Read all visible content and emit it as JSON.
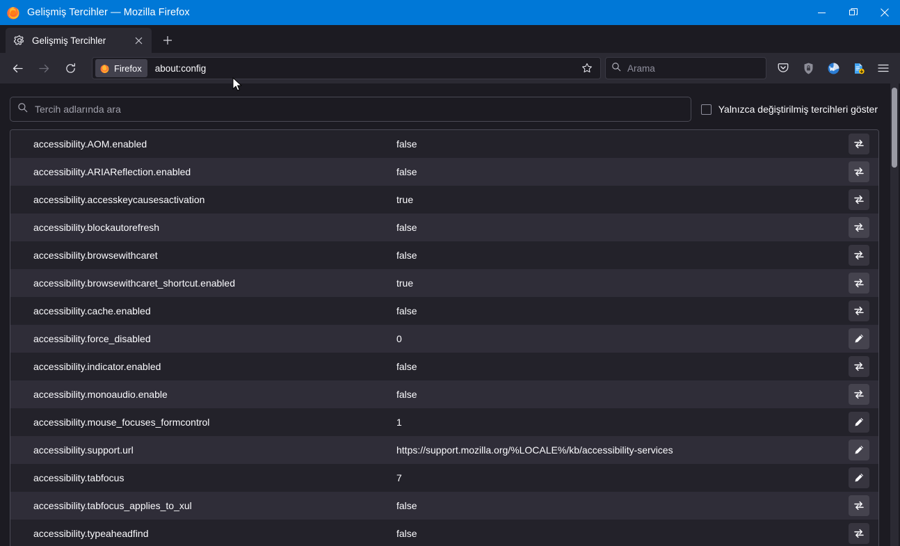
{
  "window": {
    "title": "Gelişmiş Tercihler — Mozilla Firefox",
    "controls": {
      "minimize": "minimize-icon",
      "restore": "restore-icon",
      "close": "close-icon"
    }
  },
  "tabbar": {
    "tabs": [
      {
        "favicon": "gear-icon",
        "label": "Gelişmiş Tercihler",
        "close": "close-icon"
      }
    ],
    "new_tab_label": "+"
  },
  "navbar": {
    "back": "back-arrow-icon",
    "forward": "forward-arrow-icon",
    "reload": "reload-icon",
    "identity_label": "Firefox",
    "identity_icon": "firefox-logo-icon",
    "url": "about:config",
    "bookmark": "star-icon",
    "search_placeholder": "Arama",
    "search_icon": "search-icon",
    "toolbar_icons": [
      "pocket-icon",
      "shield-lock-icon",
      "extension-w-icon",
      "download-document-icon",
      "hamburger-menu-icon"
    ]
  },
  "page": {
    "search": {
      "placeholder": "Tercih adlarında ara",
      "value": "",
      "icon": "search-icon"
    },
    "show_modified": {
      "label": "Yalnızca değiştirilmiş tercihleri göster",
      "checked": false
    },
    "prefs": [
      {
        "name": "accessibility.AOM.enabled",
        "value": "false",
        "action": "toggle-icon"
      },
      {
        "name": "accessibility.ARIAReflection.enabled",
        "value": "false",
        "action": "toggle-icon"
      },
      {
        "name": "accessibility.accesskeycausesactivation",
        "value": "true",
        "action": "toggle-icon"
      },
      {
        "name": "accessibility.blockautorefresh",
        "value": "false",
        "action": "toggle-icon"
      },
      {
        "name": "accessibility.browsewithcaret",
        "value": "false",
        "action": "toggle-icon"
      },
      {
        "name": "accessibility.browsewithcaret_shortcut.enabled",
        "value": "true",
        "action": "toggle-icon"
      },
      {
        "name": "accessibility.cache.enabled",
        "value": "false",
        "action": "toggle-icon"
      },
      {
        "name": "accessibility.force_disabled",
        "value": "0",
        "action": "edit-icon"
      },
      {
        "name": "accessibility.indicator.enabled",
        "value": "false",
        "action": "toggle-icon"
      },
      {
        "name": "accessibility.monoaudio.enable",
        "value": "false",
        "action": "toggle-icon"
      },
      {
        "name": "accessibility.mouse_focuses_formcontrol",
        "value": "1",
        "action": "edit-icon"
      },
      {
        "name": "accessibility.support.url",
        "value": "https://support.mozilla.org/%LOCALE%/kb/accessibility-services",
        "action": "edit-icon"
      },
      {
        "name": "accessibility.tabfocus",
        "value": "7",
        "action": "edit-icon"
      },
      {
        "name": "accessibility.tabfocus_applies_to_xul",
        "value": "false",
        "action": "toggle-icon"
      },
      {
        "name": "accessibility.typeaheadfind",
        "value": "false",
        "action": "toggle-icon"
      }
    ]
  },
  "colors": {
    "titlebar": "#0078d7",
    "chrome": "#2b2a33",
    "page_bg": "#1c1b22",
    "row_odd": "#23222a",
    "row_even": "#2f2d38",
    "text": "#fbfbfe"
  }
}
